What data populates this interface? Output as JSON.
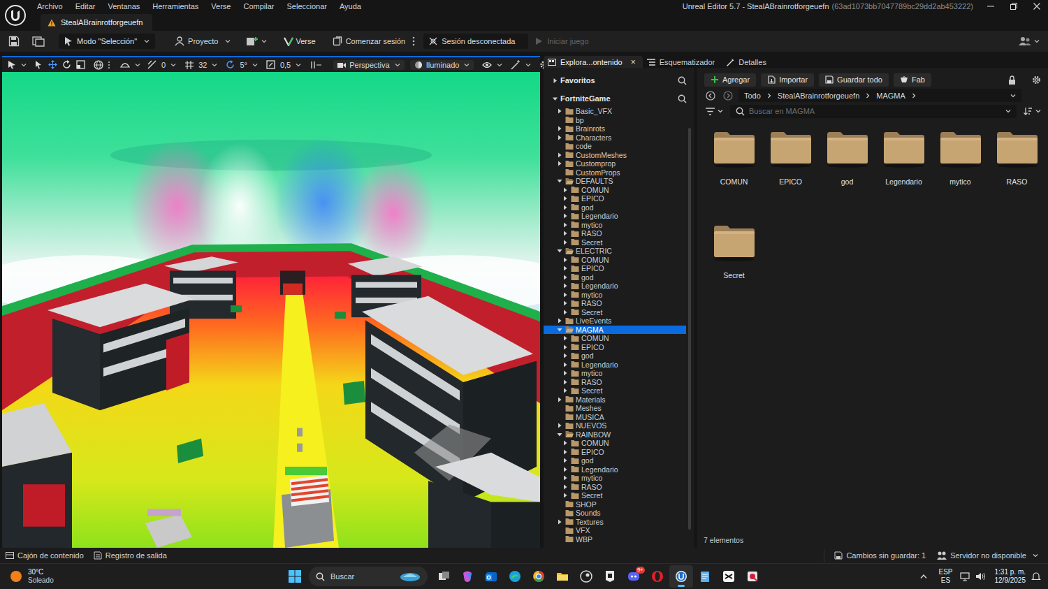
{
  "window": {
    "title": "Unreal Editor 5.7 - StealABrainrotforgeuefn",
    "title_id": "(63ad1073bb7047789bc29dd2ab453222)"
  },
  "menu": [
    "Archivo",
    "Editar",
    "Ventanas",
    "Herramientas",
    "Verse",
    "Compilar",
    "Seleccionar",
    "Ayuda"
  ],
  "document_tab": {
    "label": "StealABrainrotforgeuefn"
  },
  "toolbar": {
    "mode": "Modo \"Selección\"",
    "project": "Proyecto",
    "verse": "Verse",
    "start_session": "Comenzar sesión",
    "session_status": "Sesión desconectada",
    "play": {
      "label": "Iniciar juego",
      "disabled": true
    }
  },
  "viewport_toolbar": {
    "snaps": [
      "0",
      "32",
      "5°",
      "0,5"
    ],
    "view": "Perspectiva",
    "lighting": "Iluminado"
  },
  "panel_tabs": [
    {
      "label": "Explora...ontenido",
      "close": "×",
      "selected": true
    },
    {
      "label": "Esquematizador",
      "selected": false
    },
    {
      "label": "Detalles",
      "selected": false
    }
  ],
  "tree": {
    "favorites": "Favoritos",
    "root": "FortniteGame",
    "items": [
      {
        "label": "Basic_VFX",
        "depth": 0,
        "kind": "branch",
        "expanded": false,
        "selected": false
      },
      {
        "label": "bp",
        "depth": 0,
        "kind": "leaf",
        "expanded": false,
        "selected": false
      },
      {
        "label": "Brainrots",
        "depth": 0,
        "kind": "branch",
        "expanded": false,
        "selected": false
      },
      {
        "label": "Characters",
        "depth": 0,
        "kind": "branch",
        "expanded": false,
        "selected": false
      },
      {
        "label": "code",
        "depth": 0,
        "kind": "leaf",
        "expanded": false,
        "selected": false
      },
      {
        "label": "CustomMeshes",
        "depth": 0,
        "kind": "branch",
        "expanded": false,
        "selected": false
      },
      {
        "label": "Customprop",
        "depth": 0,
        "kind": "branch",
        "expanded": false,
        "selected": false
      },
      {
        "label": "CustomProps",
        "depth": 0,
        "kind": "leaf",
        "expanded": false,
        "selected": false
      },
      {
        "label": "DEFAULTS",
        "depth": 0,
        "kind": "branch",
        "expanded": true,
        "selected": false
      },
      {
        "label": "COMUN",
        "depth": 1,
        "kind": "branch",
        "expanded": false,
        "selected": false
      },
      {
        "label": "EPICO",
        "depth": 1,
        "kind": "branch",
        "expanded": false,
        "selected": false
      },
      {
        "label": "god",
        "depth": 1,
        "kind": "branch",
        "expanded": false,
        "selected": false
      },
      {
        "label": "Legendario",
        "depth": 1,
        "kind": "branch",
        "expanded": false,
        "selected": false
      },
      {
        "label": "mytico",
        "depth": 1,
        "kind": "branch",
        "expanded": false,
        "selected": false
      },
      {
        "label": "RASO",
        "depth": 1,
        "kind": "branch",
        "expanded": false,
        "selected": false
      },
      {
        "label": "Secret",
        "depth": 1,
        "kind": "branch",
        "expanded": false,
        "selected": false
      },
      {
        "label": "ELECTRIC",
        "depth": 0,
        "kind": "branch",
        "expanded": true,
        "selected": false
      },
      {
        "label": "COMUN",
        "depth": 1,
        "kind": "branch",
        "expanded": false,
        "selected": false
      },
      {
        "label": "EPICO",
        "depth": 1,
        "kind": "branch",
        "expanded": false,
        "selected": false
      },
      {
        "label": "god",
        "depth": 1,
        "kind": "branch",
        "expanded": false,
        "selected": false
      },
      {
        "label": "Legendario",
        "depth": 1,
        "kind": "branch",
        "expanded": false,
        "selected": false
      },
      {
        "label": "mytico",
        "depth": 1,
        "kind": "branch",
        "expanded": false,
        "selected": false
      },
      {
        "label": "RASO",
        "depth": 1,
        "kind": "branch",
        "expanded": false,
        "selected": false
      },
      {
        "label": "Secret",
        "depth": 1,
        "kind": "branch",
        "expanded": false,
        "selected": false
      },
      {
        "label": "LiveEvents",
        "depth": 0,
        "kind": "branch",
        "expanded": false,
        "selected": false
      },
      {
        "label": "MAGMA",
        "depth": 0,
        "kind": "branch",
        "expanded": true,
        "selected": true
      },
      {
        "label": "COMUN",
        "depth": 1,
        "kind": "branch",
        "expanded": false,
        "selected": false
      },
      {
        "label": "EPICO",
        "depth": 1,
        "kind": "branch",
        "expanded": false,
        "selected": false
      },
      {
        "label": "god",
        "depth": 1,
        "kind": "branch",
        "expanded": false,
        "selected": false
      },
      {
        "label": "Legendario",
        "depth": 1,
        "kind": "branch",
        "expanded": false,
        "selected": false
      },
      {
        "label": "mytico",
        "depth": 1,
        "kind": "branch",
        "expanded": false,
        "selected": false
      },
      {
        "label": "RASO",
        "depth": 1,
        "kind": "branch",
        "expanded": false,
        "selected": false
      },
      {
        "label": "Secret",
        "depth": 1,
        "kind": "branch",
        "expanded": false,
        "selected": false
      },
      {
        "label": "Materials",
        "depth": 0,
        "kind": "branch",
        "expanded": false,
        "selected": false
      },
      {
        "label": "Meshes",
        "depth": 0,
        "kind": "leaf",
        "expanded": false,
        "selected": false
      },
      {
        "label": "MUSICA",
        "depth": 0,
        "kind": "leaf",
        "expanded": false,
        "selected": false
      },
      {
        "label": "NUEVOS",
        "depth": 0,
        "kind": "branch",
        "expanded": false,
        "selected": false
      },
      {
        "label": "RAINBOW",
        "depth": 0,
        "kind": "branch",
        "expanded": true,
        "selected": false
      },
      {
        "label": "COMUN",
        "depth": 1,
        "kind": "branch",
        "expanded": false,
        "selected": false
      },
      {
        "label": "EPICO",
        "depth": 1,
        "kind": "branch",
        "expanded": false,
        "selected": false
      },
      {
        "label": "god",
        "depth": 1,
        "kind": "branch",
        "expanded": false,
        "selected": false
      },
      {
        "label": "Legendario",
        "depth": 1,
        "kind": "branch",
        "expanded": false,
        "selected": false
      },
      {
        "label": "mytico",
        "depth": 1,
        "kind": "branch",
        "expanded": false,
        "selected": false
      },
      {
        "label": "RASO",
        "depth": 1,
        "kind": "branch",
        "expanded": false,
        "selected": false
      },
      {
        "label": "Secret",
        "depth": 1,
        "kind": "branch",
        "expanded": false,
        "selected": false
      },
      {
        "label": "SHOP",
        "depth": 0,
        "kind": "leaf",
        "expanded": false,
        "selected": false
      },
      {
        "label": "Sounds",
        "depth": 0,
        "kind": "leaf",
        "expanded": false,
        "selected": false
      },
      {
        "label": "Textures",
        "depth": 0,
        "kind": "branch",
        "expanded": false,
        "selected": false
      },
      {
        "label": "VFX",
        "depth": 0,
        "kind": "leaf",
        "expanded": false,
        "selected": false
      },
      {
        "label": "WBP",
        "depth": 0,
        "kind": "leaf",
        "expanded": false,
        "selected": false
      }
    ]
  },
  "content": {
    "buttons": [
      "Agregar",
      "Importar",
      "Guardar todo",
      "Fab"
    ],
    "breadcrumb": [
      "Todo",
      "StealABrainrotforgeuefn",
      "MAGMA"
    ],
    "search": {
      "placeholder": "Buscar en MAGMA"
    },
    "folders": [
      "COMUN",
      "EPICO",
      "god",
      "Legendario",
      "mytico",
      "RASO",
      "Secret"
    ],
    "count": "7 elementos"
  },
  "status_bar": {
    "drawers": [
      "Cajón de contenido",
      "Registro de salida"
    ],
    "unsaved": "Cambios sin guardar: 1",
    "server": "Servidor no disponible"
  },
  "taskbar": {
    "temperature": "30°C",
    "weather": "Soleado",
    "search": "Buscar",
    "notification_badge": "9+",
    "language": "ESP",
    "layout": "ES",
    "time": "1:31 p. m.",
    "date": "12/9/2025"
  }
}
